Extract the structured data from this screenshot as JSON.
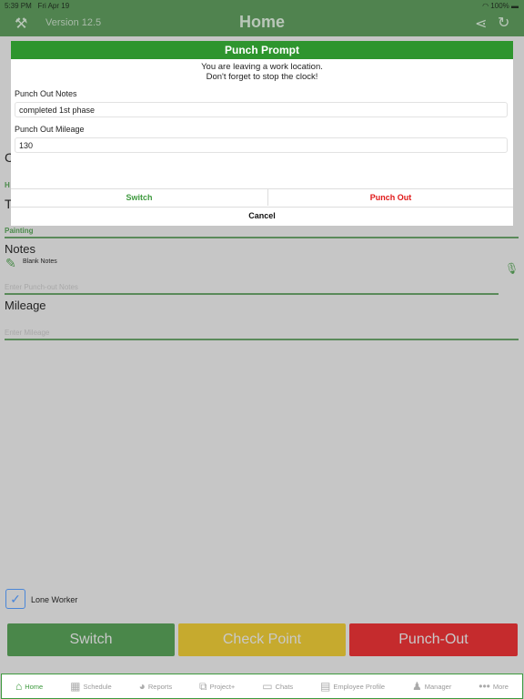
{
  "status": {
    "time": "5:39 PM",
    "date": "Fri Apr 19",
    "battery": "100%"
  },
  "header": {
    "title": "Home",
    "version": "Version 12.5"
  },
  "background": {
    "partial_c": "C",
    "partial_h": "H",
    "partial_t": "T",
    "task": "Painting",
    "notes_title": "Notes",
    "blank_notes": "Blank Notes",
    "notes_placeholder": "Enter Punch-out Notes",
    "mileage_title": "Mileage",
    "mileage_placeholder": "Enter Mileage",
    "lone_worker": "Lone Worker",
    "lone_worker_checked": true
  },
  "dialog": {
    "title": "Punch Prompt",
    "message1": "You are leaving a work location.",
    "message2": "Don't forget to stop the clock!",
    "notes_label": "Punch Out Notes",
    "notes_value": "completed 1st phase",
    "mileage_label": "Punch Out Mileage",
    "mileage_value": "130",
    "switch": "Switch",
    "punch_out": "Punch Out",
    "cancel": "Cancel"
  },
  "actions": {
    "switch": "Switch",
    "checkpoint": "Check Point",
    "punchout": "Punch-Out"
  },
  "colors": {
    "green": "#4a874a",
    "yellow": "#c6aa2e",
    "red": "#c52b2d",
    "dialog_header": "#2e952e"
  },
  "tabs": [
    {
      "label": "Home",
      "icon": "home-icon"
    },
    {
      "label": "Schedule",
      "icon": "calendar-icon"
    },
    {
      "label": "Reports",
      "icon": "pie-chart-icon"
    },
    {
      "label": "Project+",
      "icon": "project-icon"
    },
    {
      "label": "Chats",
      "icon": "chat-icon"
    },
    {
      "label": "Employee Profile",
      "icon": "id-card-icon"
    },
    {
      "label": "Manager",
      "icon": "person-icon"
    },
    {
      "label": "More",
      "icon": "more-icon"
    }
  ]
}
